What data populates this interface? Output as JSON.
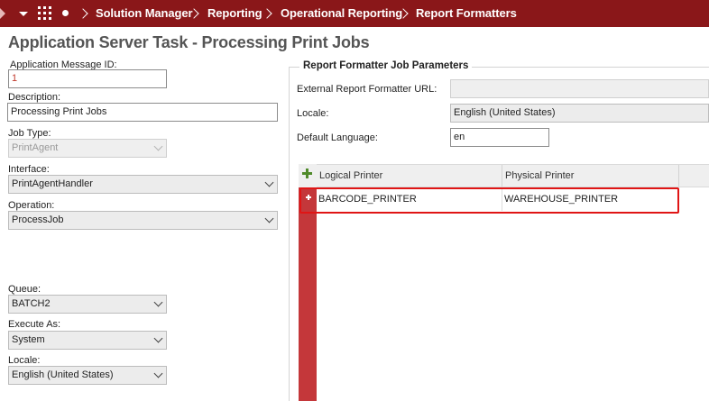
{
  "breadcrumb": [
    "Solution Manager",
    "Reporting",
    "Operational Reporting",
    "Report Formatters"
  ],
  "page": {
    "title": "Application Server Task - Processing Print Jobs"
  },
  "form": {
    "app_message_id": {
      "label": "Application Message ID:",
      "value": "1"
    },
    "description": {
      "label": "Description:",
      "value": "Processing Print Jobs"
    },
    "job_type": {
      "label": "Job Type:",
      "value": "PrintAgent"
    },
    "interface": {
      "label": "Interface:",
      "value": "PrintAgentHandler"
    },
    "operation": {
      "label": "Operation:",
      "value": "ProcessJob"
    },
    "queue": {
      "label": "Queue:",
      "value": "BATCH2"
    },
    "execute_as": {
      "label": "Execute As:",
      "value": "System"
    },
    "locale": {
      "label": "Locale:",
      "value": "English (United States)"
    }
  },
  "report_params": {
    "title": "Report Formatter Job Parameters",
    "external_url": {
      "label": "External Report Formatter URL:",
      "value": ""
    },
    "locale": {
      "label": "Locale:",
      "value": "English (United States)"
    },
    "default_language": {
      "label": "Default Language:",
      "value": "en"
    }
  },
  "grid": {
    "columns": [
      "Logical Printer",
      "Physical Printer"
    ],
    "rows": [
      {
        "logical": "BARCODE_PRINTER",
        "physical": "WAREHOUSE_PRINTER"
      }
    ]
  },
  "colors": {
    "nav_bar": "#8a1719",
    "row_strip": "#c4373a",
    "highlight_border": "#e01515",
    "add_icon": "#4f8a2a"
  },
  "icons": [
    "collapse-arrow-icon",
    "menu-caret-icon",
    "app-grid-icon",
    "dot-icon",
    "breadcrumb-chevron-icon",
    "add-icon",
    "chevron-down-icon"
  ]
}
